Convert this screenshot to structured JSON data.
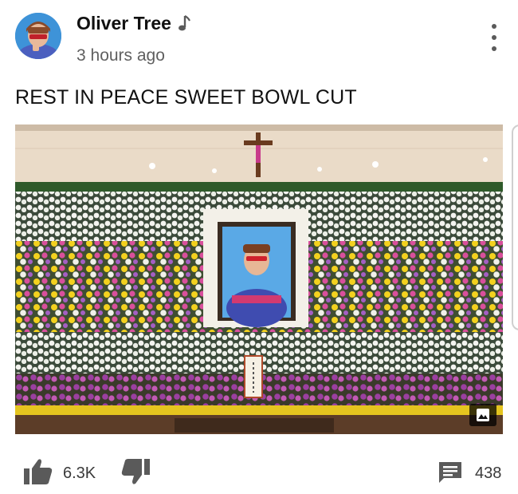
{
  "post": {
    "author_name": "Oliver Tree",
    "timestamp": "3 hours ago",
    "text": "REST IN PEACE SWEET BOWL CUT",
    "author_badge_icon": "music-note-icon",
    "menu_icon": "more-vertical-icon"
  },
  "media": {
    "description_icon": "image-icon"
  },
  "actions": {
    "like_icon": "thumbs-up-icon",
    "like_count": "6.3K",
    "dislike_icon": "thumbs-down-icon",
    "comment_icon": "comment-icon",
    "comment_count": "438"
  },
  "colors": {
    "text_primary": "#111111",
    "text_secondary": "#606060",
    "icon_gray": "#5a5a5a"
  }
}
